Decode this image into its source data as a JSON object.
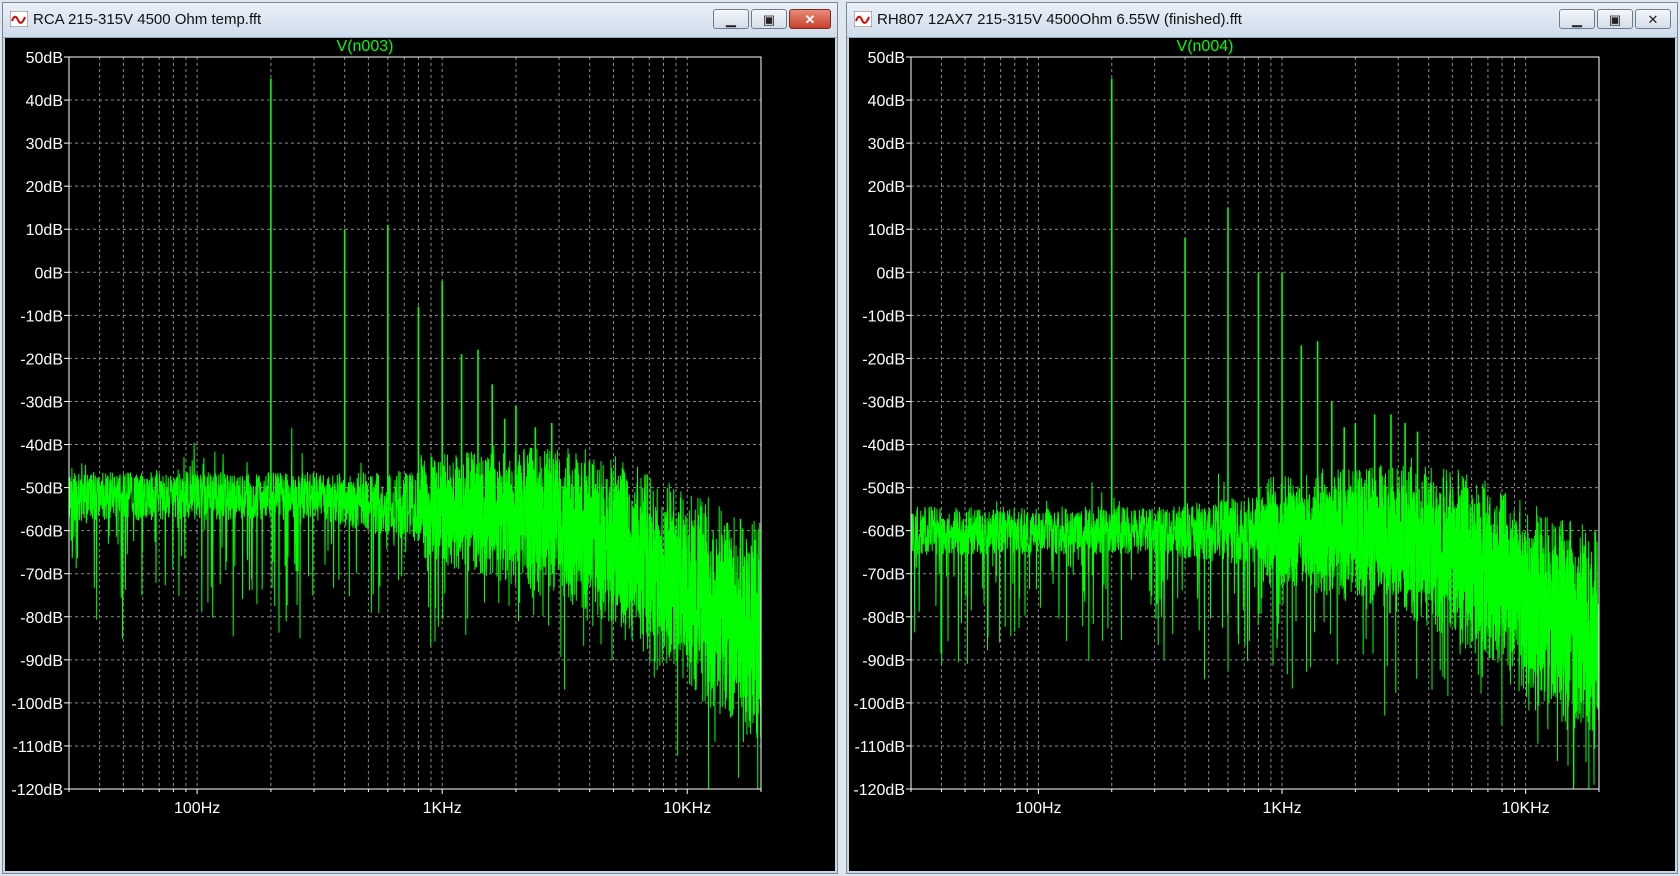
{
  "windows": [
    {
      "title": "RCA 215-315V 4500 Ohm temp.fft",
      "buttons": {
        "minimize": "▁",
        "maximize": "▣",
        "close": "✕"
      }
    },
    {
      "title": "RH807 12AX7 215-315V 4500Ohm 6.55W (finished).fft",
      "buttons": {
        "minimize": "▁",
        "maximize": "▣",
        "close": "✕"
      }
    }
  ],
  "chart_data": [
    {
      "type": "line",
      "title": "V(n003)",
      "xscale": "log",
      "xlim": [
        30,
        20000
      ],
      "ylim": [
        -120,
        50
      ],
      "yticks": [
        "50dB",
        "40dB",
        "30dB",
        "20dB",
        "10dB",
        "0dB",
        "-10dB",
        "-20dB",
        "-30dB",
        "-40dB",
        "-50dB",
        "-60dB",
        "-70dB",
        "-80dB",
        "-90dB",
        "-100dB",
        "-110dB",
        "-120dB"
      ],
      "xticks": [
        {
          "value": 100,
          "label": "100Hz"
        },
        {
          "value": 1000,
          "label": "1KHz"
        },
        {
          "value": 10000,
          "label": "10KHz"
        }
      ],
      "grid": true,
      "color": "#00ff00",
      "noise_floor": {
        "x": [
          30,
          100,
          300,
          1000,
          2000,
          3000,
          5000,
          7000,
          10000,
          15000,
          20000
        ],
        "y": [
          -52,
          -52,
          -52,
          -55,
          -57,
          -58,
          -62,
          -68,
          -74,
          -80,
          -84
        ]
      },
      "harmonics": [
        {
          "x": 200,
          "y": 45
        },
        {
          "x": 400,
          "y": 10
        },
        {
          "x": 600,
          "y": 11
        },
        {
          "x": 800,
          "y": -8
        },
        {
          "x": 1000,
          "y": -2
        },
        {
          "x": 1200,
          "y": -19
        },
        {
          "x": 1400,
          "y": -18
        },
        {
          "x": 1600,
          "y": -26
        },
        {
          "x": 1800,
          "y": -34
        },
        {
          "x": 2000,
          "y": -31
        },
        {
          "x": 2400,
          "y": -36
        },
        {
          "x": 2800,
          "y": -35
        }
      ]
    },
    {
      "type": "line",
      "title": "V(n004)",
      "xscale": "log",
      "xlim": [
        30,
        20000
      ],
      "ylim": [
        -120,
        50
      ],
      "yticks": [
        "50dB",
        "40dB",
        "30dB",
        "20dB",
        "10dB",
        "0dB",
        "-10dB",
        "-20dB",
        "-30dB",
        "-40dB",
        "-50dB",
        "-60dB",
        "-70dB",
        "-80dB",
        "-90dB",
        "-100dB",
        "-110dB",
        "-120dB"
      ],
      "xticks": [
        {
          "value": 100,
          "label": "100Hz"
        },
        {
          "value": 1000,
          "label": "1KHz"
        },
        {
          "value": 10000,
          "label": "10KHz"
        }
      ],
      "grid": true,
      "color": "#00ff00",
      "noise_floor": {
        "x": [
          30,
          100,
          300,
          1000,
          2000,
          3000,
          5000,
          7000,
          10000,
          15000,
          20000
        ],
        "y": [
          -60,
          -60,
          -60,
          -60,
          -61,
          -62,
          -65,
          -70,
          -76,
          -82,
          -86
        ]
      },
      "harmonics": [
        {
          "x": 200,
          "y": 45
        },
        {
          "x": 400,
          "y": 8
        },
        {
          "x": 600,
          "y": 15
        },
        {
          "x": 800,
          "y": 0
        },
        {
          "x": 1000,
          "y": 0
        },
        {
          "x": 1200,
          "y": -17
        },
        {
          "x": 1400,
          "y": -16
        },
        {
          "x": 1600,
          "y": -30
        },
        {
          "x": 1800,
          "y": -36
        },
        {
          "x": 2000,
          "y": -35
        },
        {
          "x": 2400,
          "y": -33
        },
        {
          "x": 2800,
          "y": -33
        },
        {
          "x": 3200,
          "y": -35
        },
        {
          "x": 3600,
          "y": -37
        }
      ]
    }
  ]
}
